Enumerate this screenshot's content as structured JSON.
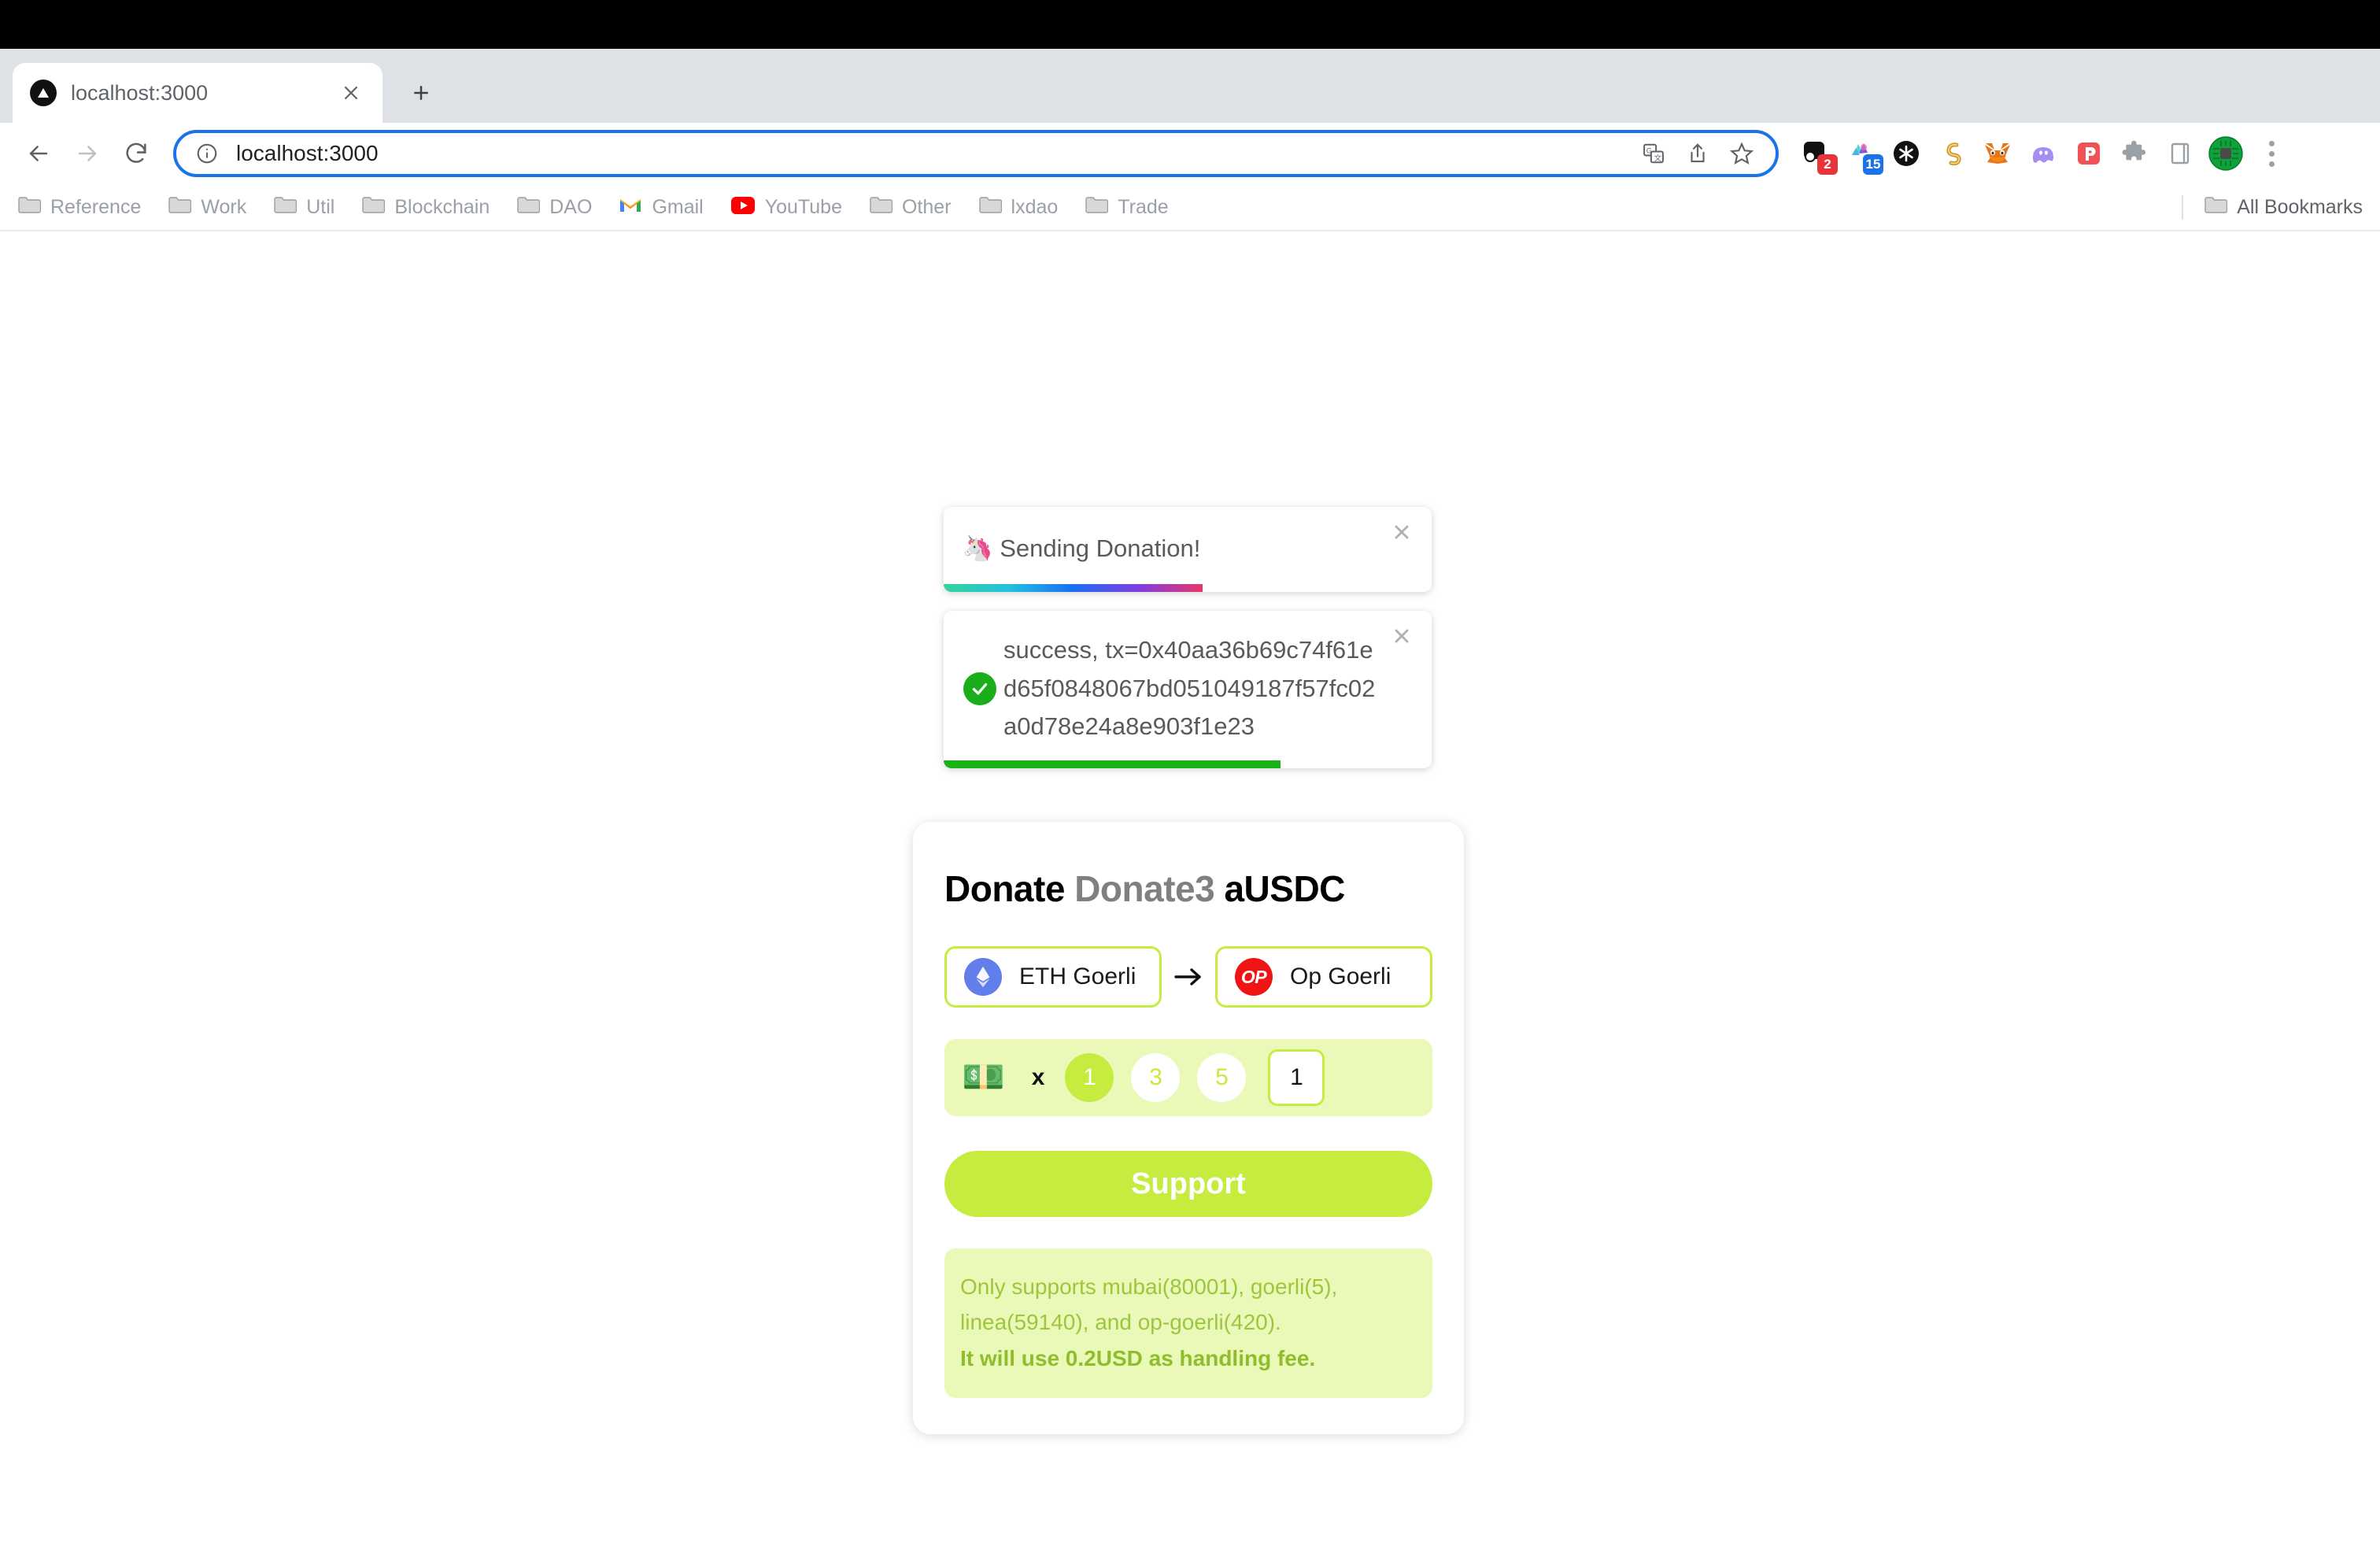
{
  "browser": {
    "tab": {
      "title": "localhost:3000",
      "favicon_name": "vercel-triangle-icon",
      "close_label": "✕"
    },
    "new_tab_label": "+",
    "nav": {
      "back_label": "←",
      "forward_label": "→",
      "reload_label": "⟳"
    },
    "omnibox": {
      "url": "localhost:3000",
      "info_icon": "info-circle-icon",
      "translate_icon": "translate-icon",
      "share_icon": "share-icon",
      "bookmark_icon": "star-icon"
    },
    "extensions": [
      {
        "name": "notion-extension-icon",
        "badge": "2",
        "badge_color": "#e8333a"
      },
      {
        "name": "raindrop-extension-icon",
        "badge": "15",
        "badge_color": "#1a73e8"
      },
      {
        "name": "asterisk-extension-icon",
        "badge": ""
      },
      {
        "name": "superhuman-extension-icon",
        "badge": ""
      },
      {
        "name": "metamask-extension-icon",
        "badge": ""
      },
      {
        "name": "phantom-extension-icon",
        "badge": ""
      },
      {
        "name": "pocket-extension-icon",
        "badge": ""
      },
      {
        "name": "puzzle-extensions-icon",
        "badge": ""
      },
      {
        "name": "side-panel-icon",
        "badge": ""
      }
    ],
    "profile_name": "profile-avatar",
    "menu_label": "chrome-menu-icon",
    "bookmarks": [
      {
        "label": "Reference",
        "icon": "folder-icon"
      },
      {
        "label": "Work",
        "icon": "folder-icon"
      },
      {
        "label": "Util",
        "icon": "folder-icon"
      },
      {
        "label": "Blockchain",
        "icon": "folder-icon"
      },
      {
        "label": "DAO",
        "icon": "folder-icon"
      },
      {
        "label": "Gmail",
        "icon": "gmail-icon"
      },
      {
        "label": "YouTube",
        "icon": "youtube-icon"
      },
      {
        "label": "Other",
        "icon": "folder-icon"
      },
      {
        "label": "lxdao",
        "icon": "folder-icon"
      },
      {
        "label": "Trade",
        "icon": "folder-icon"
      }
    ],
    "all_bookmarks_label": "All Bookmarks"
  },
  "toasts": [
    {
      "id": "sending",
      "emoji": "🦄",
      "message": "Sending Donation!",
      "close_label": "✕",
      "progress_percent": 53,
      "bar_style": "rainbow"
    },
    {
      "id": "success",
      "icon": "success-check-icon",
      "message": "success, tx=0x40aa36b69c74f61ed65f0848067bd051049187f57fc02a0d78e24a8e903f1e23",
      "close_label": "✕",
      "progress_percent": 69,
      "bar_style": "green"
    }
  ],
  "donate": {
    "title_part1": "Donate",
    "title_part2": "Donate3",
    "title_part3": "aUSDC",
    "source_chain": {
      "name": "ETH Goerli",
      "logo": "ethereum-logo-icon"
    },
    "arrow": "→",
    "target_chain": {
      "name": "Op Goerli",
      "logo": "optimism-logo-icon",
      "logo_text": "OP"
    },
    "money_emoji": "💵",
    "times_symbol": "x",
    "amount_options": [
      {
        "value": "1",
        "selected": true
      },
      {
        "value": "3",
        "selected": false
      },
      {
        "value": "5",
        "selected": false
      }
    ],
    "amount_input_value": "1",
    "support_label": "Support",
    "info_line_1": "Only supports mubai(80001), goerli(5),",
    "info_line_2": "linea(59140), and op-goerli(420).",
    "info_line_3": "It will use 0.2USD as handling fee."
  },
  "colors": {
    "accent_green": "#c5ec3e",
    "accent_green_light": "#eaf9b8",
    "info_text": "#9ec63c",
    "success_green": "#19b319",
    "eth_blue": "#627eea",
    "op_red": "#f01414",
    "omnibox_focus": "#1a73e8"
  }
}
